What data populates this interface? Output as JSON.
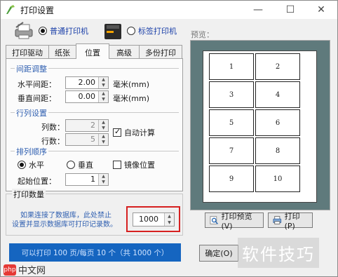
{
  "window": {
    "title": "打印设置",
    "min": "—",
    "max": "☐",
    "close": "✕"
  },
  "printer_type": {
    "normal": {
      "label": "普通打印机",
      "selected": true
    },
    "label": {
      "label": "标签打印机",
      "selected": false
    }
  },
  "tabs": [
    {
      "label": "打印驱动",
      "active": false
    },
    {
      "label": "纸张",
      "active": false
    },
    {
      "label": "位置",
      "active": true
    },
    {
      "label": "高级",
      "active": false
    },
    {
      "label": "多份打印",
      "active": false
    }
  ],
  "spacing": {
    "title": "间距调整",
    "horizontal": {
      "label": "水平间距：",
      "value": "2.00",
      "unit": "毫米(mm)"
    },
    "vertical": {
      "label": "垂直间距：",
      "value": "0.00",
      "unit": "毫米(mm)"
    }
  },
  "grid_setting": {
    "title": "行列设置",
    "columns": {
      "label": "列数：",
      "value": "2"
    },
    "rows": {
      "label": "行数：",
      "value": "5"
    },
    "auto_calc": {
      "label": "自动计算",
      "checked": true
    }
  },
  "order": {
    "title": "排列顺序",
    "horizontal": {
      "label": "水平",
      "selected": true
    },
    "vertical": {
      "label": "垂直",
      "selected": false
    },
    "mirror": {
      "label": "镜像位置",
      "checked": false
    },
    "start": {
      "label": "起始位置：",
      "value": "1"
    }
  },
  "quantity": {
    "title": "打印数量",
    "hint_line1": "如果连接了数据库，此处禁止",
    "hint_line2": "设置并显示数据库可打印记录数。",
    "value": "1000"
  },
  "status": "可以打印 100 页/每页 10 个（共 1000 个）",
  "preview": {
    "label": "预览：",
    "cells": [
      "1",
      "2",
      "3",
      "4",
      "5",
      "6",
      "7",
      "8",
      "9",
      "10"
    ],
    "print_preview_button": "打印预览(V)",
    "print_button": "打印(P)"
  },
  "ok_button": "确定(O)",
  "watermark": "软件技巧",
  "logo_text": "中文网",
  "logo_badge": "php",
  "colors": {
    "accent": "#1565c0",
    "group_label": "#2f5fb0",
    "highlight": "#d62020",
    "preview_bg": "#5f7a7c"
  },
  "icons": [
    "app-icon",
    "desktop-printer-icon",
    "label-printer-icon",
    "magnifier-icon",
    "printer-icon"
  ]
}
